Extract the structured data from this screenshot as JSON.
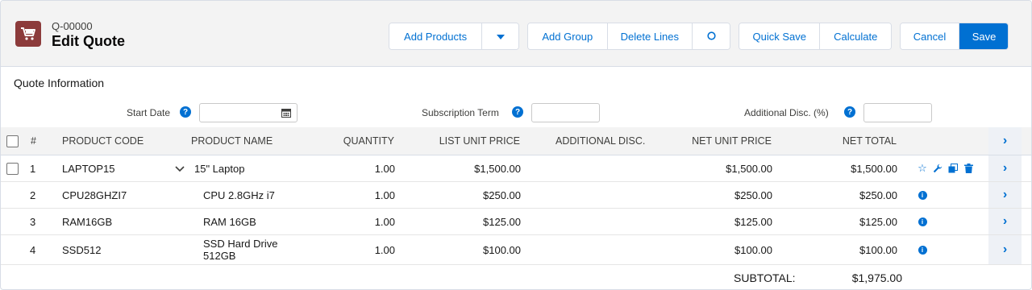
{
  "header": {
    "quote_number": "Q-00000",
    "title": "Edit Quote",
    "icon": "cart-icon"
  },
  "toolbar": {
    "add_products": "Add Products",
    "add_group": "Add Group",
    "delete_lines": "Delete Lines",
    "quick_save": "Quick Save",
    "calculate": "Calculate",
    "cancel": "Cancel",
    "save": "Save"
  },
  "quote_info": {
    "title": "Quote Information",
    "start_date_label": "Start Date",
    "start_date_value": "",
    "subscription_term_label": "Subscription Term",
    "subscription_term_value": "",
    "additional_disc_label": "Additional Disc. (%)",
    "additional_disc_value": ""
  },
  "table": {
    "columns": {
      "num": "#",
      "product_code": "PRODUCT CODE",
      "product_name": "PRODUCT NAME",
      "quantity": "QUANTITY",
      "list_unit_price": "LIST UNIT PRICE",
      "additional_disc": "ADDITIONAL DISC.",
      "net_unit_price": "NET UNIT PRICE",
      "net_total": "NET TOTAL"
    },
    "rows": [
      {
        "num": "1",
        "product_code": "LAPTOP15",
        "product_name": "15\" Laptop",
        "quantity": "1.00",
        "list_unit_price": "$1,500.00",
        "additional_disc": "",
        "net_unit_price": "$1,500.00",
        "net_total": "$1,500.00"
      },
      {
        "num": "2",
        "product_code": "CPU28GHZI7",
        "product_name": "CPU 2.8GHz i7",
        "quantity": "1.00",
        "list_unit_price": "$250.00",
        "additional_disc": "",
        "net_unit_price": "$250.00",
        "net_total": "$250.00"
      },
      {
        "num": "3",
        "product_code": "RAM16GB",
        "product_name": "RAM 16GB",
        "quantity": "1.00",
        "list_unit_price": "$125.00",
        "additional_disc": "",
        "net_unit_price": "$125.00",
        "net_total": "$125.00"
      },
      {
        "num": "4",
        "product_code": "SSD512",
        "product_name_line1": "SSD Hard Drive",
        "product_name_line2": "512GB",
        "quantity": "1.00",
        "list_unit_price": "$100.00",
        "additional_disc": "",
        "net_unit_price": "$100.00",
        "net_total": "$100.00"
      }
    ],
    "subtotal_label": "SUBTOTAL:",
    "subtotal_value": "$1,975.00"
  },
  "colors": {
    "brand_icon_bg": "#8c3b3b",
    "accent": "#0070d2",
    "header_bg": "#f3f3f3"
  }
}
